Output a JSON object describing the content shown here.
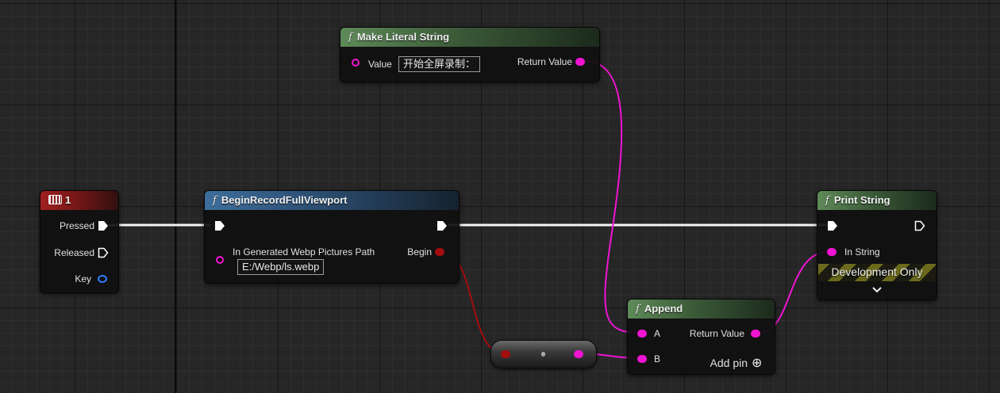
{
  "nodes": {
    "make_literal_string": {
      "title": "Make Literal String",
      "value_label": "Value",
      "value": "开始全屏录制：",
      "return_label": "Return Value"
    },
    "key_event": {
      "title": "1",
      "pressed_label": "Pressed",
      "released_label": "Released",
      "key_label": "Key"
    },
    "begin_record": {
      "title": "BeginRecordFullViewport",
      "path_label": "In Generated Webp Pictures Path",
      "path_value": "E:/Webp/ls.webp",
      "begin_label": "Begin"
    },
    "append": {
      "title": "Append",
      "a_label": "A",
      "b_label": "B",
      "return_label": "Return Value",
      "add_pin_label": "Add pin"
    },
    "print_string": {
      "title": "Print String",
      "in_string_label": "In String",
      "dev_only_label": "Development Only"
    }
  },
  "icons": {
    "function": "f",
    "keyboard": "keyboard-icon",
    "add_pin": "⊕",
    "expand": "chevron-down-icon"
  },
  "colors": {
    "string_pin": "#f014d2",
    "bool_pin": "#a30d0d",
    "struct_pin": "#2f7dff",
    "exec_wire": "#ffffff",
    "function_header": "#5e8a58",
    "event_header": "#a02020",
    "latent_header": "#3d6e9c"
  }
}
